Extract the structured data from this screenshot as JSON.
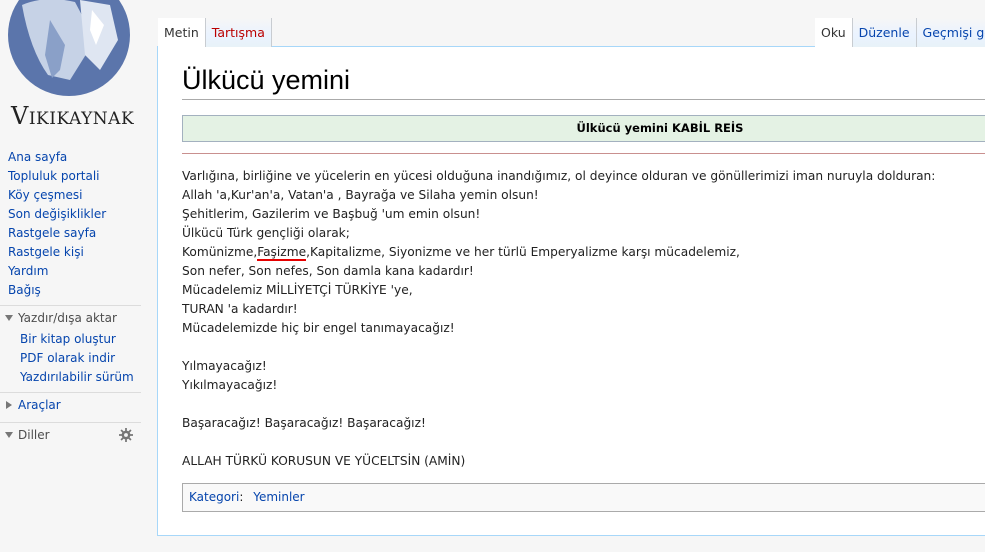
{
  "logo": {
    "text_first": "V",
    "text_rest": "IKIKAYNAK"
  },
  "nav": {
    "items": [
      "Ana sayfa",
      "Topluluk portali",
      "Köy çeşmesi",
      "Son değişiklikler",
      "Rastgele sayfa",
      "Rastgele kişi",
      "Yardım",
      "Bağış"
    ]
  },
  "print_export": {
    "heading": "Yazdır/dışa aktar",
    "items": [
      "Bir kitap oluştur",
      "PDF olarak indir",
      "Yazdırılabilir sürüm"
    ]
  },
  "tools": {
    "heading": "Araçlar"
  },
  "languages": {
    "heading": "Diller"
  },
  "tabs": {
    "left": [
      {
        "label": "Metin",
        "state": "selected"
      },
      {
        "label": "Tartışma",
        "state": "new"
      }
    ],
    "right": [
      {
        "label": "Oku",
        "state": "selected"
      },
      {
        "label": "Düzenle",
        "state": "normal"
      },
      {
        "label": "Geçmişi gör",
        "state": "normal"
      }
    ]
  },
  "page": {
    "title": "Ülkücü yemini",
    "header_box": "Ülkücü yemini KABİL REİS",
    "lines": [
      "Varlığına, birliğine ve yücelerin en yücesi olduğuna inandığımız, ol deyince olduran ve gönüllerimizi iman nuruyla dolduran:",
      "Allah 'a,Kur'an'a, Vatan'a , Bayrağa ve Silaha yemin olsun!",
      "Şehitlerim, Gazilerim ve Başbuğ 'um emin olsun!",
      "Ülkücü Türk gençliği olarak;"
    ],
    "line5": {
      "before": "Komünizme,",
      "misspelled": "Faşizme",
      "after": ",Kapitalizme, Siyonizme ve her türlü Emperyalizme karşı mücadelemiz,"
    },
    "lines2": [
      "Son nefer, Son nefes, Son damla kana kadardır!",
      "Mücadelemiz MİLLİYETÇİ TÜRKİYE 'ye,",
      "TURAN 'a kadardır!",
      "Mücadelemizde hiç bir engel tanımayacağız!"
    ],
    "lines3": [
      "Yılmayacağız!",
      "Yıkılmayacağız!"
    ],
    "line4": "Başaracağız! Başaracağız! Başaracağız!",
    "line_final": "ALLAH TÜRKÜ KORUSUN VE YÜCELTSİN (AMİN)",
    "category_label": "Kategori",
    "category_colon": ":",
    "category_link": "Yeminler"
  },
  "colors": {
    "link": "#0645ad",
    "new_link": "#ba0000",
    "header_bg": "#e4f2e4",
    "misspell": "#e60000"
  }
}
